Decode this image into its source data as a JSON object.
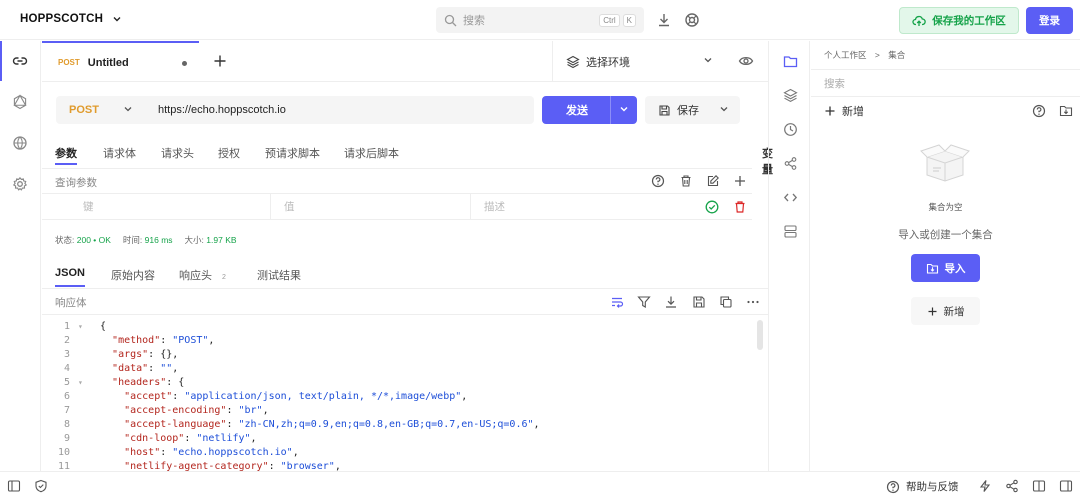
{
  "topbar": {
    "brand": "HOPPSCOTCH",
    "search_placeholder": "搜索",
    "kbd_ctrl": "Ctrl",
    "kbd_k": "K",
    "save_workspace": "保存我的工作区",
    "login": "登录"
  },
  "tab": {
    "method": "POST",
    "title": "Untitled"
  },
  "environment": {
    "label": "选择环境"
  },
  "request": {
    "method": "POST",
    "url": "https://echo.hoppscotch.io",
    "send": "发送",
    "save": "保存"
  },
  "request_tabs": [
    "参数",
    "请求体",
    "请求头",
    "授权",
    "预请求脚本",
    "请求后脚本"
  ],
  "variables": "变量",
  "query_params": {
    "label": "查询参数",
    "key_placeholder": "键",
    "value_placeholder": "值",
    "desc_placeholder": "描述"
  },
  "status": {
    "status_label": "状态:",
    "status_value": "200 • OK",
    "time_label": "时间:",
    "time_value": "916 ms",
    "size_label": "大小:",
    "size_value": "1.97 KB"
  },
  "response_tabs": [
    {
      "label": "JSON"
    },
    {
      "label": "原始内容"
    },
    {
      "label": "响应头",
      "badge": "2"
    },
    {
      "label": "测试结果"
    }
  ],
  "response_body_label": "响应体",
  "code_lines": [
    {
      "n": "1",
      "fold": true,
      "parts": [
        [
          "p",
          "{"
        ]
      ]
    },
    {
      "n": "2",
      "parts": [
        [
          "p",
          "  "
        ],
        [
          "k",
          "\"method\""
        ],
        [
          "p",
          ": "
        ],
        [
          "s",
          "\"POST\""
        ],
        [
          "p",
          ","
        ]
      ]
    },
    {
      "n": "3",
      "parts": [
        [
          "p",
          "  "
        ],
        [
          "k",
          "\"args\""
        ],
        [
          "p",
          ": {},"
        ]
      ]
    },
    {
      "n": "4",
      "parts": [
        [
          "p",
          "  "
        ],
        [
          "k",
          "\"data\""
        ],
        [
          "p",
          ": "
        ],
        [
          "s",
          "\"\""
        ],
        [
          "p",
          ","
        ]
      ]
    },
    {
      "n": "5",
      "fold": true,
      "parts": [
        [
          "p",
          "  "
        ],
        [
          "k",
          "\"headers\""
        ],
        [
          "p",
          ": {"
        ]
      ]
    },
    {
      "n": "6",
      "parts": [
        [
          "p",
          "    "
        ],
        [
          "k",
          "\"accept\""
        ],
        [
          "p",
          ": "
        ],
        [
          "s",
          "\"application/json, text/plain, */*,image/webp\""
        ],
        [
          "p",
          ","
        ]
      ]
    },
    {
      "n": "7",
      "parts": [
        [
          "p",
          "    "
        ],
        [
          "k",
          "\"accept-encoding\""
        ],
        [
          "p",
          ": "
        ],
        [
          "s",
          "\"br\""
        ],
        [
          "p",
          ","
        ]
      ]
    },
    {
      "n": "8",
      "parts": [
        [
          "p",
          "    "
        ],
        [
          "k",
          "\"accept-language\""
        ],
        [
          "p",
          ": "
        ],
        [
          "s",
          "\"zh-CN,zh;q=0.9,en;q=0.8,en-GB;q=0.7,en-US;q=0.6\""
        ],
        [
          "p",
          ","
        ]
      ]
    },
    {
      "n": "9",
      "parts": [
        [
          "p",
          "    "
        ],
        [
          "k",
          "\"cdn-loop\""
        ],
        [
          "p",
          ": "
        ],
        [
          "s",
          "\"netlify\""
        ],
        [
          "p",
          ","
        ]
      ]
    },
    {
      "n": "10",
      "parts": [
        [
          "p",
          "    "
        ],
        [
          "k",
          "\"host\""
        ],
        [
          "p",
          ": "
        ],
        [
          "s",
          "\"echo.hoppscotch.io\""
        ],
        [
          "p",
          ","
        ]
      ]
    },
    {
      "n": "11",
      "parts": [
        [
          "p",
          "    "
        ],
        [
          "k",
          "\"netlify-agent-category\""
        ],
        [
          "p",
          ": "
        ],
        [
          "s",
          "\"browser\""
        ],
        [
          "p",
          ","
        ]
      ]
    }
  ],
  "right_panel": {
    "breadcrumb_1": "个人工作区",
    "breadcrumb_sep": ">",
    "breadcrumb_2": "集合",
    "search_placeholder": "搜索",
    "add_new": "新增",
    "empty_title": "集合为空",
    "empty_subtitle": "导入或创建一个集合",
    "import": "导入",
    "new": "新增"
  },
  "bottombar": {
    "help": "帮助与反馈"
  },
  "colors": {
    "accent": "#5b5ef5",
    "success": "#16a34a",
    "method": "#e09b2d"
  }
}
